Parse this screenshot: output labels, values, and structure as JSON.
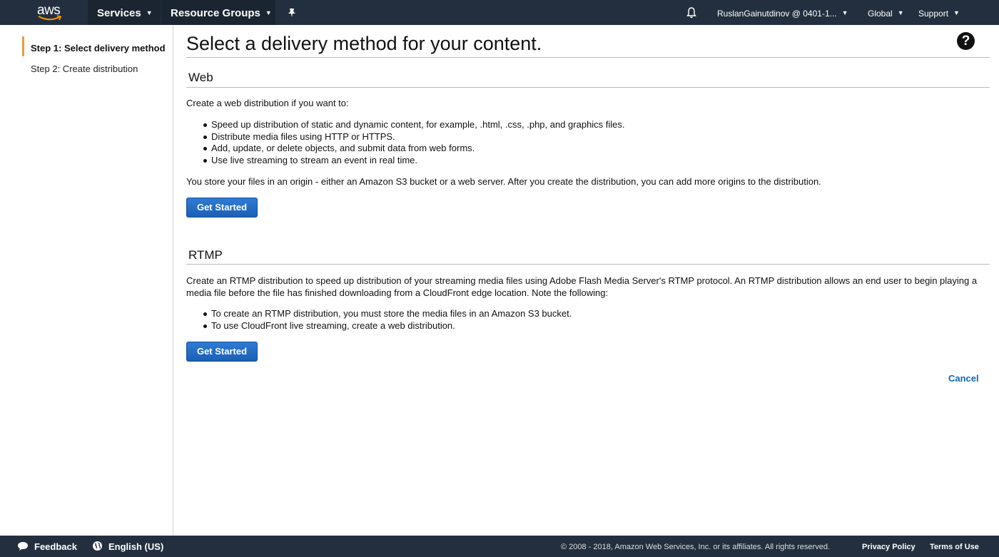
{
  "header": {
    "logo_text": "aws",
    "services_label": "Services",
    "resource_groups_label": "Resource Groups",
    "pin_icon": "pin-icon",
    "bell_icon": "bell-icon",
    "account_label": "RuslanGainutdinov @ 0401-1...",
    "region_label": "Global",
    "support_label": "Support"
  },
  "sidebar": {
    "steps": [
      {
        "label": "Step 1: Select delivery method",
        "active": true
      },
      {
        "label": "Step 2: Create distribution",
        "active": false
      }
    ]
  },
  "main": {
    "title": "Select a delivery method for your content.",
    "help_icon": "help-icon",
    "web": {
      "heading": "Web",
      "intro": "Create a web distribution if you want to:",
      "bullets": [
        "Speed up distribution of static and dynamic content, for example, .html, .css, .php, and graphics files.",
        "Distribute media files using HTTP or HTTPS.",
        "Add, update, or delete objects, and submit data from web forms.",
        "Use live streaming to stream an event in real time."
      ],
      "note": "You store your files in an origin - either an Amazon S3 bucket or a web server. After you create the distribution, you can add more origins to the distribution.",
      "button_label": "Get Started"
    },
    "rtmp": {
      "heading": "RTMP",
      "intro": "Create an RTMP distribution to speed up distribution of your streaming media files using Adobe Flash Media Server's RTMP protocol. An RTMP distribution allows an end user to begin playing a media file before the file has finished downloading from a CloudFront edge location. Note the following:",
      "bullets": [
        "To create an RTMP distribution, you must store the media files in an Amazon S3 bucket.",
        "To use CloudFront live streaming, create a web distribution."
      ],
      "button_label": "Get Started"
    },
    "cancel_label": "Cancel"
  },
  "footer": {
    "feedback_label": "Feedback",
    "language_label": "English (US)",
    "copyright": "© 2008 - 2018, Amazon Web Services, Inc. or its affiliates. All rights reserved.",
    "privacy_label": "Privacy Policy",
    "terms_label": "Terms of Use"
  },
  "colors": {
    "nav_bg": "#232f3e",
    "accent_orange": "#e7a03a",
    "button_blue": "#1b5fb5",
    "link_blue": "#1166bb"
  }
}
